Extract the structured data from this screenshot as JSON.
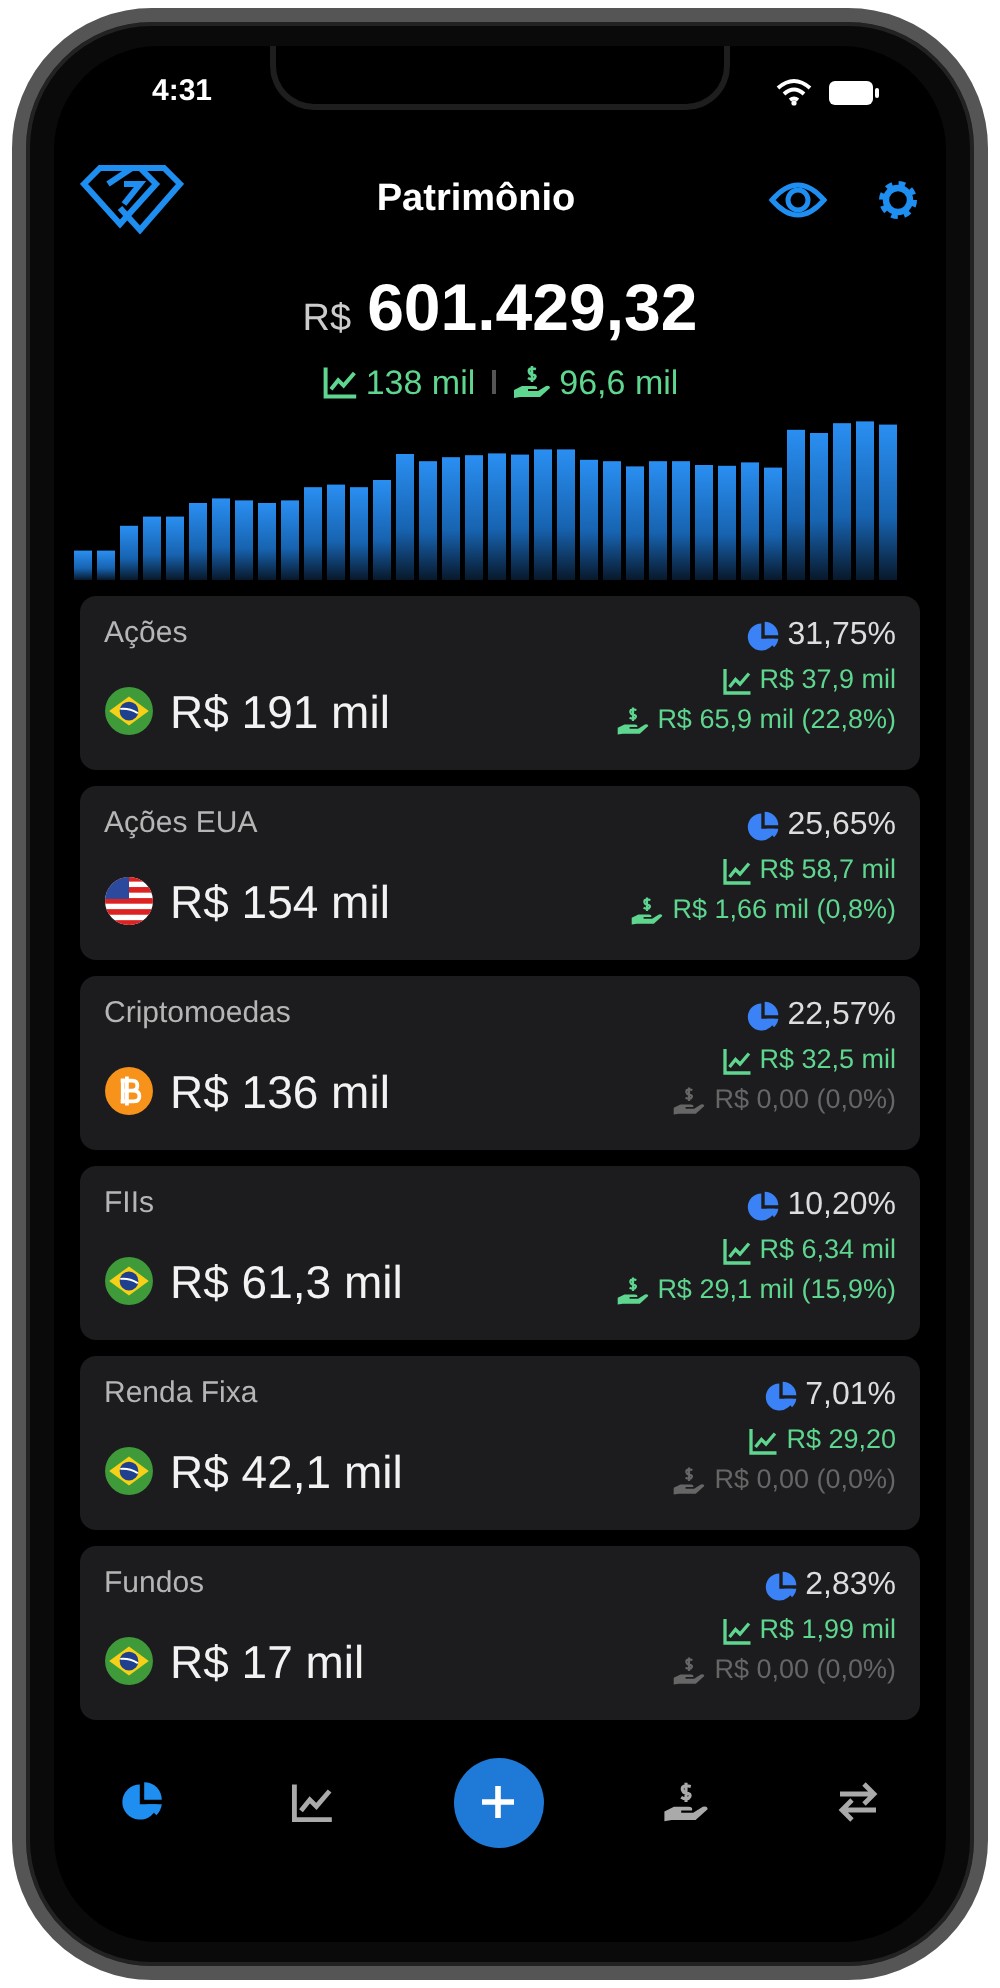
{
  "status_bar": {
    "time": "4:31"
  },
  "header": {
    "title": "Patrimônio"
  },
  "total": {
    "currency": "R$",
    "value": "601.429,32"
  },
  "summary": {
    "gain": "138 mil",
    "dividends": "96,6 mil"
  },
  "categories": [
    {
      "name": "Ações",
      "kind": "brazil",
      "value": "R$ 191 mil",
      "share": "31,75%",
      "gain": "R$ 37,9 mil",
      "dividends": "R$ 65,9 mil (22,8%)",
      "dividends_dimmed": false
    },
    {
      "name": "Ações EUA",
      "kind": "usa",
      "value": "R$ 154 mil",
      "share": "25,65%",
      "gain": "R$ 58,7 mil",
      "dividends": "R$ 1,66 mil (0,8%)",
      "dividends_dimmed": false
    },
    {
      "name": "Criptomoedas",
      "kind": "bitcoin",
      "value": "R$ 136 mil",
      "share": "22,57%",
      "gain": "R$ 32,5 mil",
      "dividends": "R$ 0,00 (0,0%)",
      "dividends_dimmed": true
    },
    {
      "name": "FIIs",
      "kind": "brazil",
      "value": "R$ 61,3 mil",
      "share": "10,20%",
      "gain": "R$ 6,34 mil",
      "dividends": "R$ 29,1 mil (15,9%)",
      "dividends_dimmed": false
    },
    {
      "name": "Renda Fixa",
      "kind": "brazil",
      "value": "R$ 42,1 mil",
      "share": "7,01%",
      "gain": "R$ 29,20",
      "dividends": "R$ 0,00 (0,0%)",
      "dividends_dimmed": true
    },
    {
      "name": "Fundos",
      "kind": "brazil",
      "value": "R$ 17 mil",
      "share": "2,83%",
      "gain": "R$ 1,99 mil",
      "dividends": "R$ 0,00 (0,0%)",
      "dividends_dimmed": true
    }
  ],
  "tabs": [
    {
      "kind": "portfolio",
      "selected": true
    },
    {
      "kind": "chart",
      "selected": false
    },
    {
      "kind": "add",
      "selected": false
    },
    {
      "kind": "dividends",
      "selected": false
    },
    {
      "kind": "transfer",
      "selected": false
    }
  ]
}
